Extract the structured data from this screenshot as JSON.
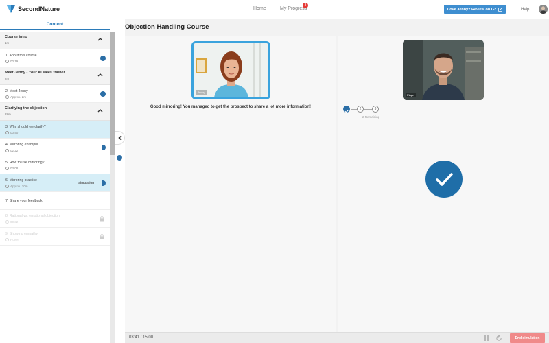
{
  "header": {
    "logo_text": "SecondNature",
    "nav": {
      "home": "Home",
      "progress": "My Progress",
      "progress_badge": "3"
    },
    "review_button": "Love Jenny? Review on G2",
    "help": "Help"
  },
  "sidebar": {
    "tab": "Content",
    "sections": [
      {
        "title": "Course intro",
        "duration": "1m"
      },
      {
        "title": "Meet Jenny - Your AI sales trainer",
        "duration": "2m"
      },
      {
        "title": "Clarifying the objection",
        "duration": "28m"
      }
    ],
    "items": [
      {
        "title": "1. About this course",
        "meta": "00:19",
        "status": "done"
      },
      {
        "title": "2. Meet Jenny",
        "meta": "Approx. 2m",
        "status": "done"
      },
      {
        "title": "3. Why should we clarify?",
        "meta": "00:40",
        "status": "active"
      },
      {
        "title": "4. Mirroring example",
        "meta": "02:22",
        "status": "partial"
      },
      {
        "title": "5. How to use mirroring?",
        "meta": "03:08",
        "status": "none"
      },
      {
        "title": "6. Mirroring practice",
        "meta": "Approx. 10m",
        "status": "partial",
        "tag": "Simulation"
      },
      {
        "title": "7. Share your feedback",
        "meta": "",
        "status": "none"
      },
      {
        "title": "8. Rational vs. emotional objection",
        "meta": "00:32",
        "status": "locked"
      },
      {
        "title": "9. Showing empathy",
        "meta": "Hover",
        "status": "locked"
      }
    ]
  },
  "main": {
    "title": "Objection Handling Course",
    "agent_label": "Jenny",
    "player_label": "Player",
    "feedback": "Good mirroring! You managed to get the prospect to share a lot more information!",
    "steps": [
      "1",
      "2",
      "3"
    ],
    "remaining": "2 Remaining",
    "timer": "03:41 / 15:00",
    "end_button": "End simulation"
  },
  "colors": {
    "accent": "#2b6ea6",
    "highlight": "#3aa3dd",
    "end": "#f08a8a"
  }
}
